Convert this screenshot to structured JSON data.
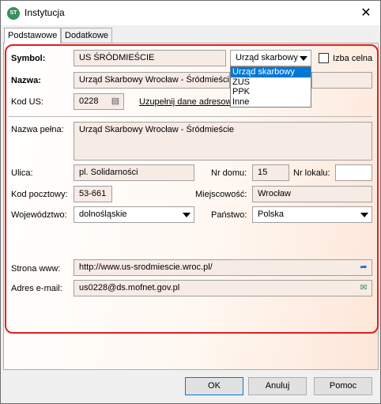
{
  "window": {
    "title": "Instytucja",
    "icon_text": "ST",
    "close": "✕"
  },
  "tabs": [
    {
      "label": "Podstawowe"
    },
    {
      "label": "Dodatkowe"
    }
  ],
  "form": {
    "symbol_label": "Symbol:",
    "symbol_value": "US ŚRÓDMIEŚCIE",
    "type_selected": "Urząd skarbowy",
    "type_options": [
      "Urząd skarbowy",
      "ZUS",
      "PPK",
      "Inne"
    ],
    "izba_label": "Izba celna",
    "nazwa_label": "Nazwa:",
    "nazwa_value": "Urząd Skarbowy Wrocław - Śródmieście",
    "kod_us_label": "Kod US:",
    "kod_us_value": "0228",
    "uzupelnij_label": "Uzupełnij dane adresowe",
    "nazwa_pelna_label": "Nazwa pełna:",
    "nazwa_pelna_value": "Urząd Skarbowy Wrocław - Śródmieście",
    "ulica_label": "Ulica:",
    "ulica_value": "pl. Solidarności",
    "nr_domu_label": "Nr domu:",
    "nr_domu_value": "15",
    "nr_lokalu_label": "Nr lokalu:",
    "nr_lokalu_value": "",
    "kod_pocztowy_label": "Kod pocztowy:",
    "kod_pocztowy_value": "53-661",
    "miejscowosc_label": "Miejscowość:",
    "miejscowosc_value": "Wrocław",
    "wojewodztwo_label": "Województwo:",
    "wojewodztwo_value": "dolnośląskie",
    "panstwo_label": "Państwo:",
    "panstwo_value": "Polska",
    "www_label": "Strona www:",
    "www_value": "http://www.us-srodmiescie.wroc.pl/",
    "email_label": "Adres e-mail:",
    "email_value": "us0228@ds.mofnet.gov.pl"
  },
  "buttons": {
    "ok": "OK",
    "cancel": "Anuluj",
    "help": "Pomoc"
  },
  "colors": {
    "highlight": "#e41e1e",
    "selection": "#0078d7"
  }
}
